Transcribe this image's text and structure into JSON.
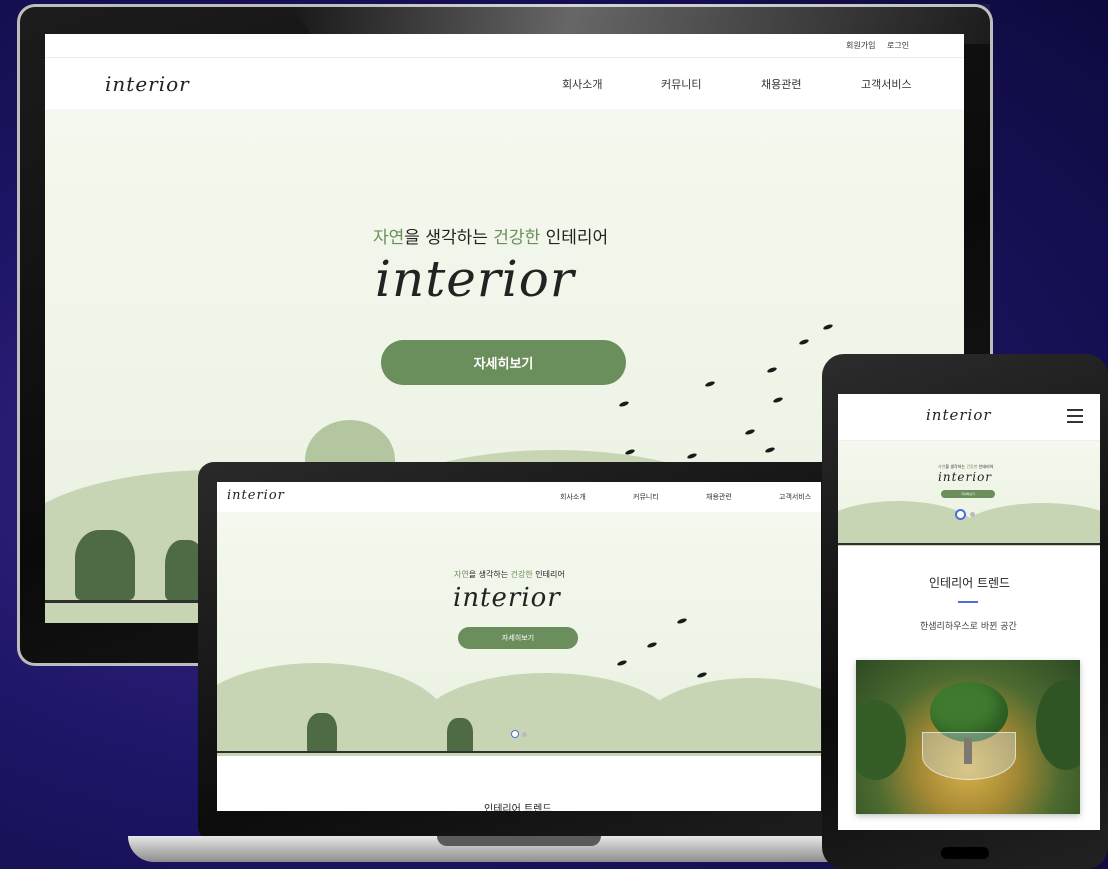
{
  "site": {
    "logo": "interior",
    "top_links": [
      "회원가입",
      "로그인"
    ],
    "nav": [
      "회사소개",
      "커뮤니티",
      "채용관련",
      "고객서비스"
    ],
    "tagline_parts": {
      "p1": "자연",
      "p2": "을 생각하는 ",
      "p3": "건강한",
      "p4": " 인테리어"
    },
    "hero_title": "interior",
    "cta": "자세히보기"
  },
  "section": {
    "title": "인테리어 트렌드",
    "subtitle": "한샘리하우스로 바뀐 공간"
  },
  "colors": {
    "accent_green": "#6b8f5c",
    "highlight_blue": "#4a6fd6",
    "background": "#1d1566"
  },
  "icons": {
    "menu": "hamburger-icon"
  }
}
